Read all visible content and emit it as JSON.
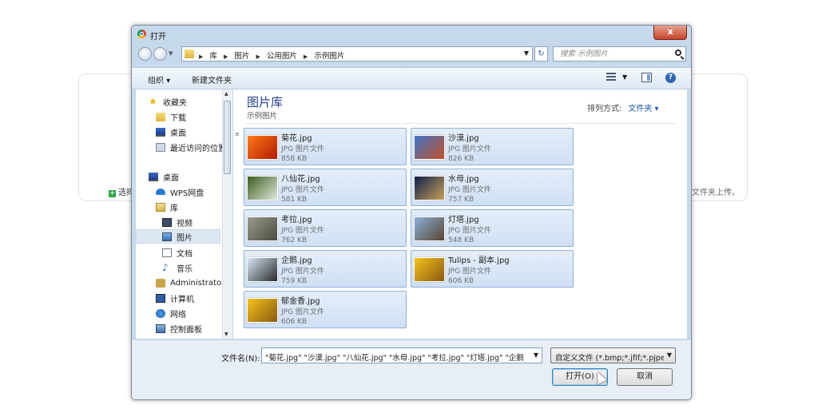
{
  "background": {
    "select_label": "选择",
    "hint_text": "文件夹上传。",
    "blurred_heading": "..."
  },
  "dialog": {
    "title": "打开",
    "close_label": "x",
    "breadcrumbs": [
      "库",
      "图片",
      "公用图片",
      "示例图片"
    ],
    "search_placeholder": "搜索 示例图片",
    "toolbar": {
      "organize": "组织 ▾",
      "new_folder": "新建文件夹"
    },
    "nav": [
      {
        "label": "收藏夹",
        "icon": "star-icon"
      },
      {
        "label": "下载",
        "icon": "folder-icon"
      },
      {
        "label": "桌面",
        "icon": "desktop-icon"
      },
      {
        "label": "最近访问的位置",
        "icon": "recent-icon"
      },
      {
        "label": "桌面",
        "icon": "desktop-icon"
      },
      {
        "label": "WPS网盘",
        "icon": "cloud-icon"
      },
      {
        "label": "库",
        "icon": "library-icon"
      },
      {
        "label": "视频",
        "icon": "video-icon"
      },
      {
        "label": "图片",
        "icon": "picture-icon"
      },
      {
        "label": "文档",
        "icon": "document-icon"
      },
      {
        "label": "音乐",
        "icon": "music-icon"
      },
      {
        "label": "Administrator",
        "icon": "user-folder-icon"
      },
      {
        "label": "计算机",
        "icon": "computer-icon"
      },
      {
        "label": "网络",
        "icon": "network-icon"
      },
      {
        "label": "控制面板",
        "icon": "control-panel-icon"
      }
    ],
    "content": {
      "library_title": "图片库",
      "library_subtitle": "示例图片",
      "arrange_label": "排列方式:",
      "arrange_value": "文件夹 ▾"
    },
    "files": [
      {
        "name": "菊花.jpg",
        "type": "JPG 图片文件",
        "size": "858 KB",
        "c1": "#ff7a1a",
        "c2": "#b21a00"
      },
      {
        "name": "沙漠.jpg",
        "type": "JPG 图片文件",
        "size": "826 KB",
        "c1": "#3f77c9",
        "c2": "#c4502a"
      },
      {
        "name": "八仙花.jpg",
        "type": "JPG 图片文件",
        "size": "581 KB",
        "c1": "#3d5e22",
        "c2": "#dfe8d8"
      },
      {
        "name": "水母.jpg",
        "type": "JPG 图片文件",
        "size": "757 KB",
        "c1": "#0d1f4a",
        "c2": "#c9a05a"
      },
      {
        "name": "考拉.jpg",
        "type": "JPG 图片文件",
        "size": "762 KB",
        "c1": "#9a9a8c",
        "c2": "#4a4a40"
      },
      {
        "name": "灯塔.jpg",
        "type": "JPG 图片文件",
        "size": "548 KB",
        "c1": "#8ab0d8",
        "c2": "#5a4630"
      },
      {
        "name": "企鹅.jpg",
        "type": "JPG 图片文件",
        "size": "759 KB",
        "c1": "#d6e6f4",
        "c2": "#2a2a2a"
      },
      {
        "name": "Tulips - 副本.jpg",
        "type": "JPG 图片文件",
        "size": "606 KB",
        "c1": "#f4c21a",
        "c2": "#8a5a10"
      },
      {
        "name": "郁金香.jpg",
        "type": "JPG 图片文件",
        "size": "606 KB",
        "c1": "#f4c21a",
        "c2": "#8a5a10"
      }
    ],
    "footer": {
      "filename_label": "文件名(N):",
      "filename_value": "\"菊花.jpg\" \"沙漠.jpg\" \"八仙花.jpg\" \"水母.jpg\" \"考拉.jpg\" \"灯塔.jpg\" \"企鹅",
      "filter_value": "自定义文件 (*.bmp;*.jfif;*.pjpe",
      "open_label": "打开(O)",
      "cancel_label": "取消"
    }
  }
}
